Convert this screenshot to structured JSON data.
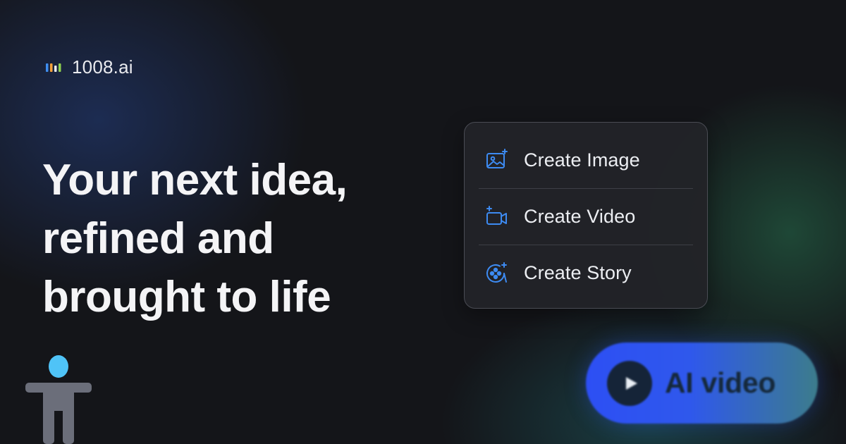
{
  "brand": {
    "name": "1008.ai",
    "logo_colors": [
      "#3f8ef0",
      "#f4a13a",
      "#e9eaee",
      "#8fd14f"
    ]
  },
  "headline": {
    "lines": [
      "Your next idea,",
      "refined and",
      "brought to life"
    ]
  },
  "menu": {
    "items": [
      {
        "label": "Create Image",
        "icon": "image-sparkle-icon"
      },
      {
        "label": "Create Video",
        "icon": "video-camera-sparkle-icon"
      },
      {
        "label": "Create Story",
        "icon": "film-reel-sparkle-icon"
      }
    ]
  },
  "cta": {
    "label": "AI video",
    "icon": "play-icon"
  },
  "colors": {
    "background": "#141519",
    "accent_icon": "#3d8bf2",
    "card_bg": "#222328",
    "pill_start": "#2d4ff4",
    "pill_end": "#3c7c8c",
    "a11y_head": "#4fc3f7",
    "a11y_body": "#6b6e7a"
  },
  "accessibility": {
    "icon": "accessibility-figure-icon"
  }
}
